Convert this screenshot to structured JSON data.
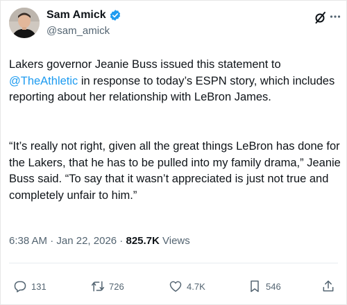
{
  "author": {
    "display_name": "Sam Amick",
    "handle": "@sam_amick"
  },
  "icons": {
    "avatar": "avatar",
    "verified": "verified-badge-icon",
    "grok": "grok-icon",
    "more": "more-icon",
    "reply": "reply-icon",
    "repost": "repost-icon",
    "like": "like-icon",
    "bookmark": "bookmark-icon",
    "share": "share-icon"
  },
  "colors": {
    "accent": "#1d9bf0",
    "text": "#0f1419",
    "muted": "#536471"
  },
  "tweet": {
    "para1_before": "Lakers governor Jeanie Buss issued this statement to ",
    "mention": "@TheAthletic",
    "para1_after": " in response to today’s ESPN story, which includes reporting about her relationship with LeBron James.",
    "para2": "“It’s really not right, given all the great things LeBron has done for the Lakers, that he has to be pulled into my family drama,” Jeanie Buss said. “To say that it wasn’t appreciated is just not true and completely unfair to him.”"
  },
  "meta": {
    "time": "6:38 AM",
    "separator": " · ",
    "date": "Jan 22, 2026",
    "views_count": "825.7K",
    "views_label": " Views"
  },
  "actions": {
    "replies": "131",
    "reposts": "726",
    "likes": "4.7K",
    "bookmarks": "546"
  }
}
